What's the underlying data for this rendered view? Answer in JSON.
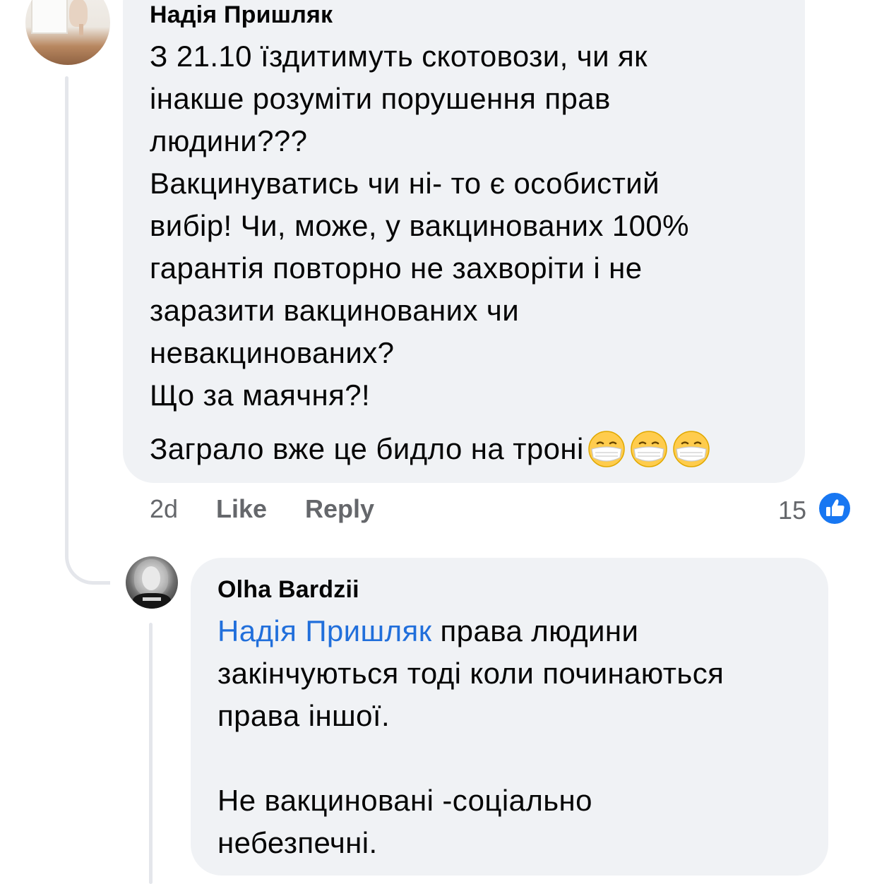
{
  "comment": {
    "author": "Надія Пришляк",
    "lines": [
      "З 21.10 їздитимуть скотовози, чи як",
      "інакше розуміти порушення прав",
      "людини???",
      "Вакцинуватись чи ні- то є особистий",
      "вибір! Чи, може, у вакцинованих 100%",
      "гарантія повторно не захворіти і не",
      "заразити вакцинованих чи",
      "невакцинованих?",
      "Що за маячня?!",
      "Заграло вже це бидло на троні"
    ],
    "emoji": [
      "face-with-medical-mask-icon",
      "face-with-medical-mask-icon",
      "face-with-medical-mask-icon"
    ],
    "time": "2d",
    "like_label": "Like",
    "reply_label": "Reply",
    "reaction_count": "15",
    "reaction_icon": "thumbs-up-icon"
  },
  "reply": {
    "author": "Olha Bardzii",
    "mention": "Надія Пришляк",
    "lines": [
      " права людини",
      "закінчуються тоді коли починаються",
      "права іншої.",
      "Не вакциновані -соціально",
      "небезпечні."
    ]
  },
  "colors": {
    "bubble": "#f0f2f5",
    "mention": "#216fdb",
    "meta": "#65676b",
    "like_badge": "#1877f2"
  }
}
